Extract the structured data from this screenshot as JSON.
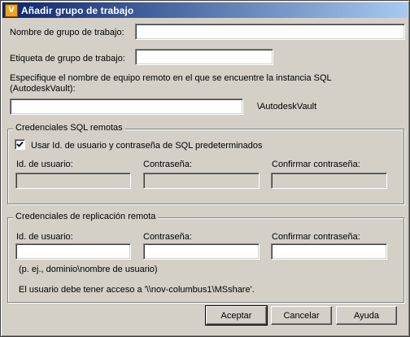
{
  "window": {
    "title": "Añadir grupo de trabajo",
    "icon_name": "autodesk-vault-icon"
  },
  "form": {
    "workgroup_name_label": "Nombre de grupo de trabajo:",
    "workgroup_name_value": "",
    "workgroup_tag_label": "Etiqueta de grupo de trabajo:",
    "workgroup_tag_value": "",
    "remote_computer_label_line1": "Especifique el nombre de equipo remoto en el que se encuentre la instancia SQL",
    "remote_computer_label_line2": "(AutodeskVault):",
    "remote_computer_value": "",
    "instance_suffix": "\\AutodeskVault"
  },
  "sql_credentials": {
    "title": "Credenciales SQL remotas",
    "use_default_label": "Usar Id. de usuario y contraseña de SQL predeterminados",
    "use_default_checked": true,
    "user_id_label": "Id. de usuario:",
    "password_label": "Contraseña:",
    "confirm_password_label": "Confirmar contraseña:"
  },
  "replication_credentials": {
    "title": "Credenciales de replicación remota",
    "user_id_label": "Id. de usuario:",
    "password_label": "Contraseña:",
    "confirm_password_label": "Confirmar contraseña:",
    "hint": "(p. ej., dominio\\nombre de usuario)",
    "access_note": "El usuario debe tener acceso a '\\\\nov-columbus1\\MSshare'."
  },
  "buttons": {
    "accept": "Aceptar",
    "cancel": "Cancelar",
    "help": "Ayuda"
  }
}
